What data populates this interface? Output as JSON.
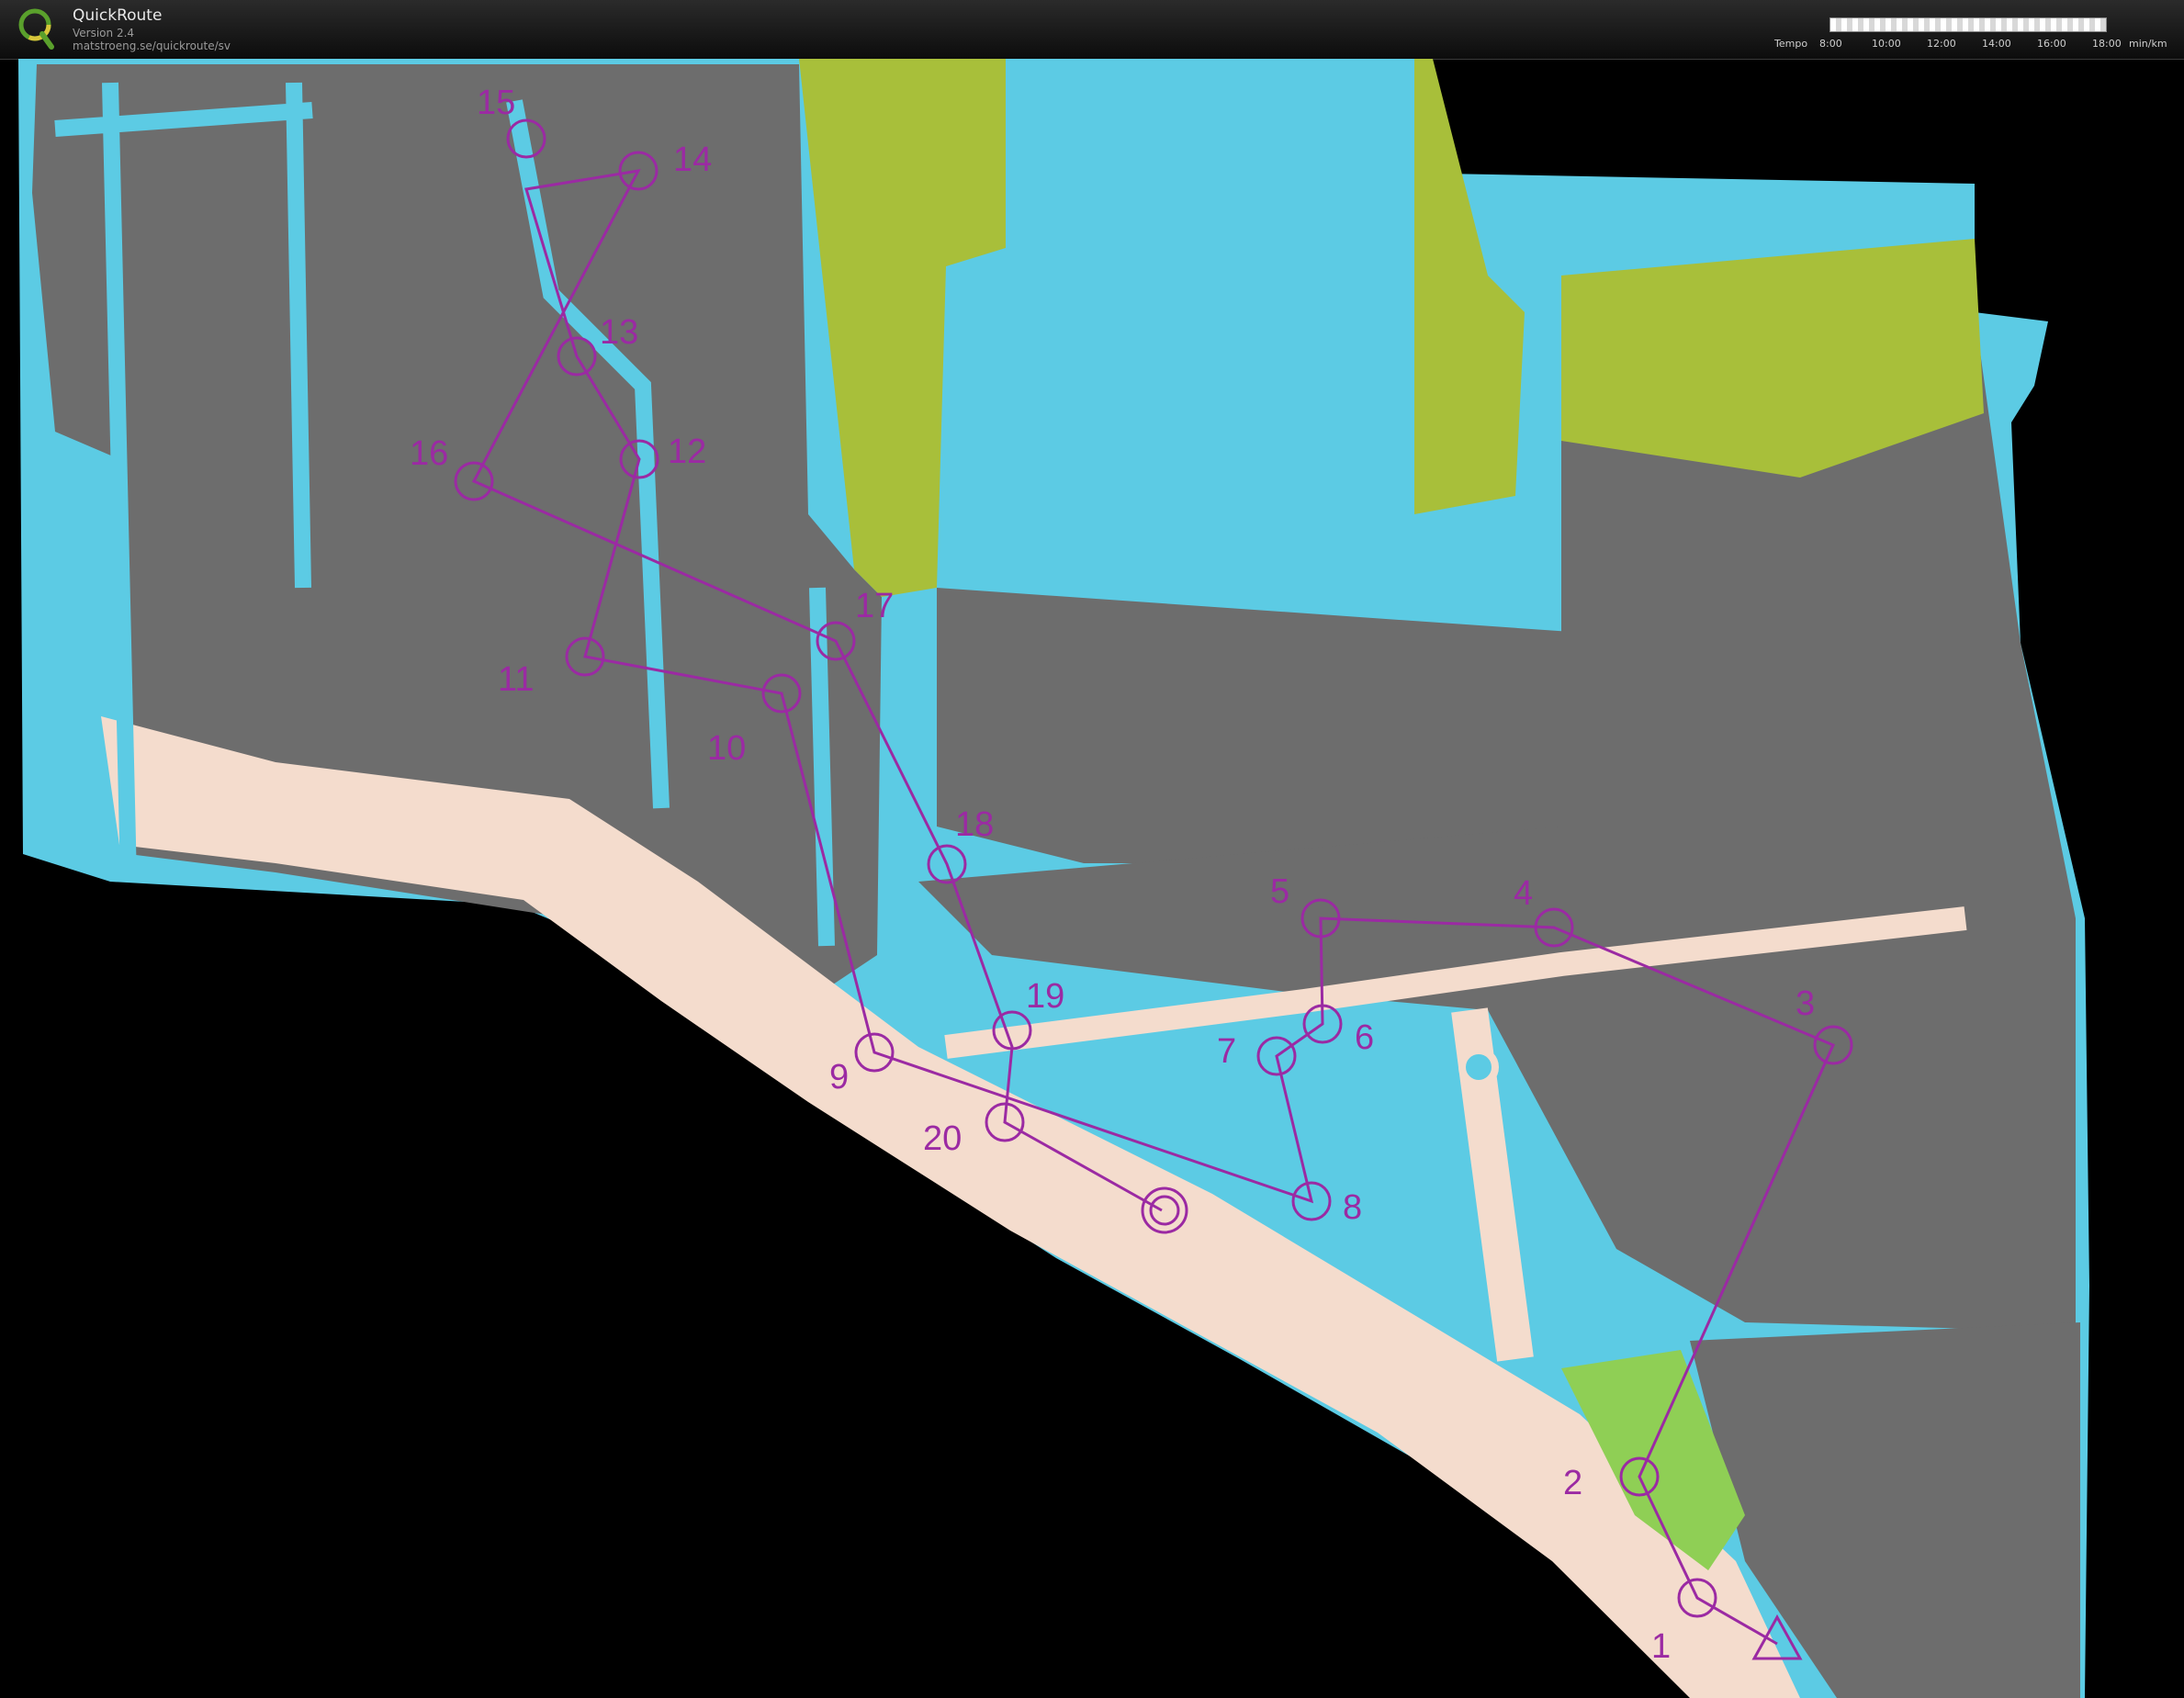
{
  "app": {
    "title": "QuickRoute",
    "version": "Version 2.4",
    "url": "matstroeng.se/quickroute/sv"
  },
  "tempo_scale": {
    "label": "Tempo",
    "ticks": [
      "8:00",
      "10:00",
      "12:00",
      "14:00",
      "16:00",
      "18:00"
    ],
    "unit": "min/km"
  },
  "colors": {
    "background": "#000000",
    "water": "#5ccbe4",
    "building": "#6d6d6d",
    "paved": "#f4dccd",
    "vegetation": "#a8bf3a",
    "course": "#9b2aa3"
  },
  "course": {
    "start_label": "start-triangle",
    "controls": [
      {
        "num": "1"
      },
      {
        "num": "2"
      },
      {
        "num": "3"
      },
      {
        "num": "4"
      },
      {
        "num": "5"
      },
      {
        "num": "6"
      },
      {
        "num": "7"
      },
      {
        "num": "8"
      },
      {
        "num": "9"
      },
      {
        "num": "10"
      },
      {
        "num": "11"
      },
      {
        "num": "12"
      },
      {
        "num": "13"
      },
      {
        "num": "14"
      },
      {
        "num": "15"
      },
      {
        "num": "16"
      },
      {
        "num": "17"
      },
      {
        "num": "18"
      },
      {
        "num": "19"
      },
      {
        "num": "20"
      }
    ],
    "finish_label": "finish-double-circle"
  }
}
